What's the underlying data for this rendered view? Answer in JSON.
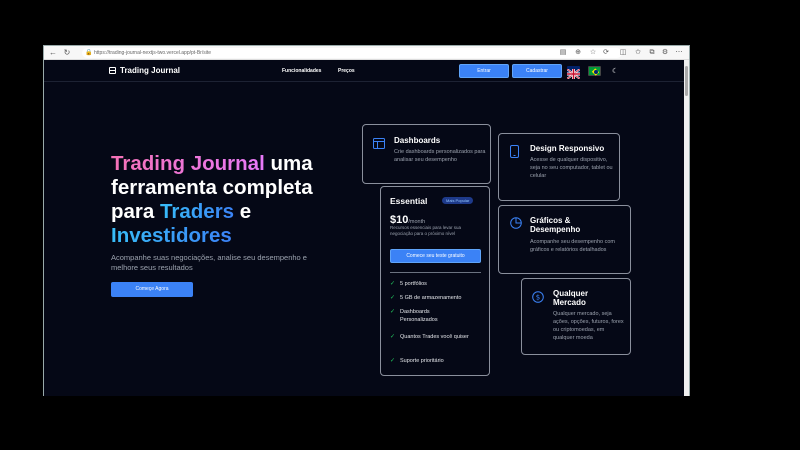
{
  "browser": {
    "url": "https://trading-journal-nextjs-two.vercel.app/pt-Br/site"
  },
  "nav": {
    "logo": "Trading Journal",
    "links": [
      "Funcionalidades",
      "Preços"
    ],
    "login": "Entrar",
    "signup": "Cadastrar"
  },
  "hero": {
    "title_a": "Trading Journal",
    "title_b": " uma ferramenta completa para ",
    "title_c": "Traders",
    "title_d": " e ",
    "title_e": "Investidores",
    "subtitle": "Acompanhe suas negociações, analise seu desempenho e melhore seus resultados",
    "cta": "Começe Agora"
  },
  "cards": {
    "dashboards": {
      "title": "Dashboards",
      "text": "Crie dashboards personalizados para analisar seu desempenho",
      "icon": "layout-icon"
    },
    "responsive": {
      "title": "Design Responsivo",
      "text": "Acesse de qualquer dispositivo, seja no seu computador, tablet ou celular",
      "icon": "smartphone-icon"
    },
    "charts": {
      "title": "Gráficos & Desempenho",
      "text": "Acompanhe seu desempenho com gráficos e relatórios detalhados",
      "icon": "pie-chart-icon"
    },
    "market": {
      "title": "Qualquer Mercado",
      "text": "Qualquer mercado, seja ações, opções, futuros, forex ou criptomoedas, em qualquer moeda",
      "icon": "dollar-circle-icon"
    }
  },
  "pricing": {
    "plan": "Essential",
    "badge": "Mais Popular",
    "price": "$10",
    "period": "/month",
    "description": "Recursos essenciais para levar sua negociação para o próximo nível",
    "button": "Comece seu teste gratuito",
    "features": [
      "5 portfólios",
      "5 GB de armazenamento",
      "Dashboards Personalizados",
      "Quantos Trades você quiser",
      "Suporte prioritário"
    ]
  },
  "colors": {
    "accent": "#3b82f6",
    "background": "#050816",
    "pink": "#f472b6",
    "check": "#22c55e"
  }
}
